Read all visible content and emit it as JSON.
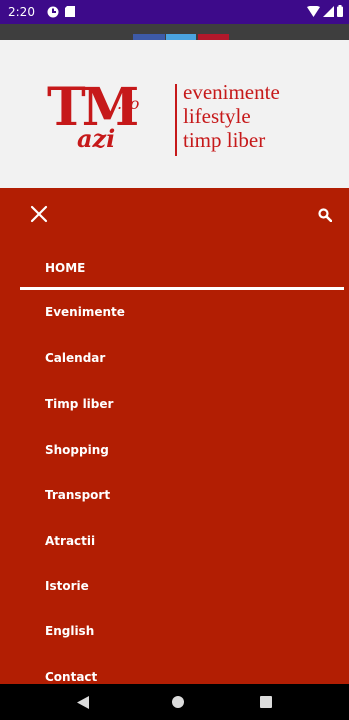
{
  "status_bar": {
    "time": "2:20"
  },
  "header": {
    "logo": {
      "tm": "TM",
      "ro": ".ro",
      "azi": "azi"
    },
    "tagline": [
      "evenimente",
      "lifestyle",
      "timp liber"
    ]
  },
  "menu": {
    "items": [
      "HOME",
      "Evenimente",
      "Calendar",
      "Timp liber",
      "Shopping",
      "Transport",
      "Atractii",
      "Istorie",
      "English",
      "Contact"
    ],
    "active_index": 0
  },
  "colors": {
    "status_bar": "#3d0a8a",
    "brand_red": "#c6191a",
    "menu_bg": "#b21e03",
    "strip": [
      "#3d5aa8",
      "#4aa3e0",
      "#b2182b"
    ]
  }
}
